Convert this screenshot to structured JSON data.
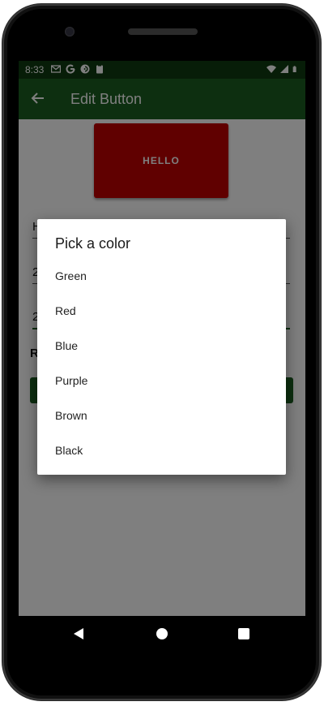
{
  "status_bar": {
    "time": "8:33",
    "left_icons": [
      "gmail-icon",
      "google-icon",
      "pocket-casts-icon",
      "clipboard-icon"
    ],
    "right_icons": [
      "wifi-icon",
      "signal-icon",
      "battery-icon"
    ]
  },
  "app_bar": {
    "title": "Edit Button",
    "back_icon": "arrow-back-icon",
    "color": "#1b5e20"
  },
  "preview": {
    "label": "HELLO",
    "color": "#c00000"
  },
  "form": {
    "field1_value": "H",
    "field2_value": "2",
    "field3_value": "2",
    "section_label": "R"
  },
  "dialog": {
    "title": "Pick a color",
    "options": [
      "Green",
      "Red",
      "Blue",
      "Purple",
      "Brown",
      "Black"
    ]
  },
  "colors": {
    "status_bar": "#0f3a10",
    "accent": "#1b5e20",
    "scrim": "rgba(0,0,0,0.5)"
  }
}
